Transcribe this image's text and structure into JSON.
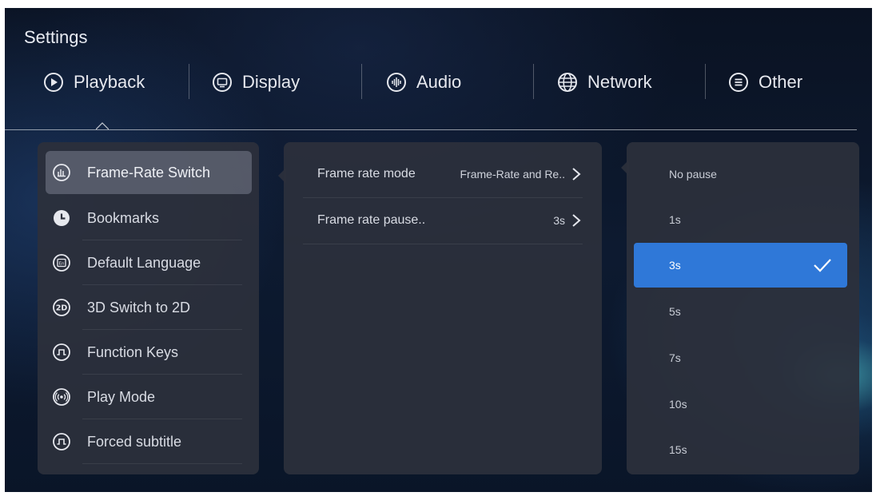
{
  "app": {
    "title": "Settings"
  },
  "tabs": [
    {
      "label": "Playback",
      "icon": "play-circle-icon",
      "selected": true
    },
    {
      "label": "Display",
      "icon": "monitor-icon"
    },
    {
      "label": "Audio",
      "icon": "audio-wave-icon"
    },
    {
      "label": "Network",
      "icon": "globe-icon"
    },
    {
      "label": "Other",
      "icon": "menu-circle-icon"
    }
  ],
  "sidebar": {
    "items": [
      {
        "label": "Frame-Rate Switch",
        "icon": "frame-rate-icon",
        "active": true
      },
      {
        "label": "Bookmarks",
        "icon": "clock-icon"
      },
      {
        "label": "Default Language",
        "icon": "language-icon"
      },
      {
        "label": "3D Switch to 2D",
        "icon": "2d-icon"
      },
      {
        "label": "Function Keys",
        "icon": "function-keys-icon"
      },
      {
        "label": "Play Mode",
        "icon": "play-mode-icon"
      },
      {
        "label": "Forced subtitle",
        "icon": "subtitle-icon"
      }
    ]
  },
  "detail": {
    "rows": [
      {
        "label": "Frame rate mode",
        "value": "Frame-Rate and Re.."
      },
      {
        "label": "Frame rate pause..",
        "value": "3s"
      }
    ]
  },
  "options": {
    "items": [
      "No pause",
      "1s",
      "3s",
      "5s",
      "7s",
      "10s",
      "15s"
    ],
    "selected": "3s"
  },
  "colors": {
    "accent": "#2f78d8",
    "panel": "#2c303c",
    "background": "#0c1426"
  }
}
